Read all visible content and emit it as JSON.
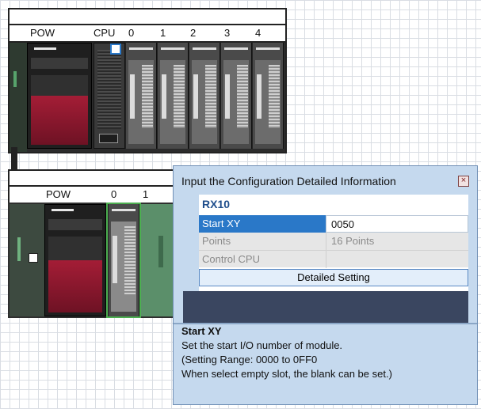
{
  "top_rack": {
    "slot_labels": [
      "POW",
      "CPU",
      "0",
      "1",
      "2",
      "3",
      "4"
    ]
  },
  "bottom_rack": {
    "slot_labels": [
      "POW",
      "0",
      "1"
    ]
  },
  "dialog": {
    "title": "Input the Configuration Detailed Information",
    "close_glyph": "×",
    "module_name": "RX10",
    "rows": [
      {
        "label": "Start XY",
        "value": "0050"
      },
      {
        "label": "Points",
        "value": "16 Points"
      },
      {
        "label": "Control CPU",
        "value": ""
      }
    ],
    "detailed_setting_label": "Detailed Setting",
    "help": {
      "heading": "Start XY",
      "line1": "Set the start I/O number of module.",
      "line2": "(Setting Range: 0000 to 0FF0",
      "line3": "When select empty slot, the blank can be set.)"
    }
  },
  "colors": {
    "selected_row": "#2a78c8",
    "dialog_bg": "#c5d9ee",
    "dark_band": "#3a4660",
    "module_highlight": "#4caf50"
  },
  "icons": [
    "close-icon"
  ]
}
